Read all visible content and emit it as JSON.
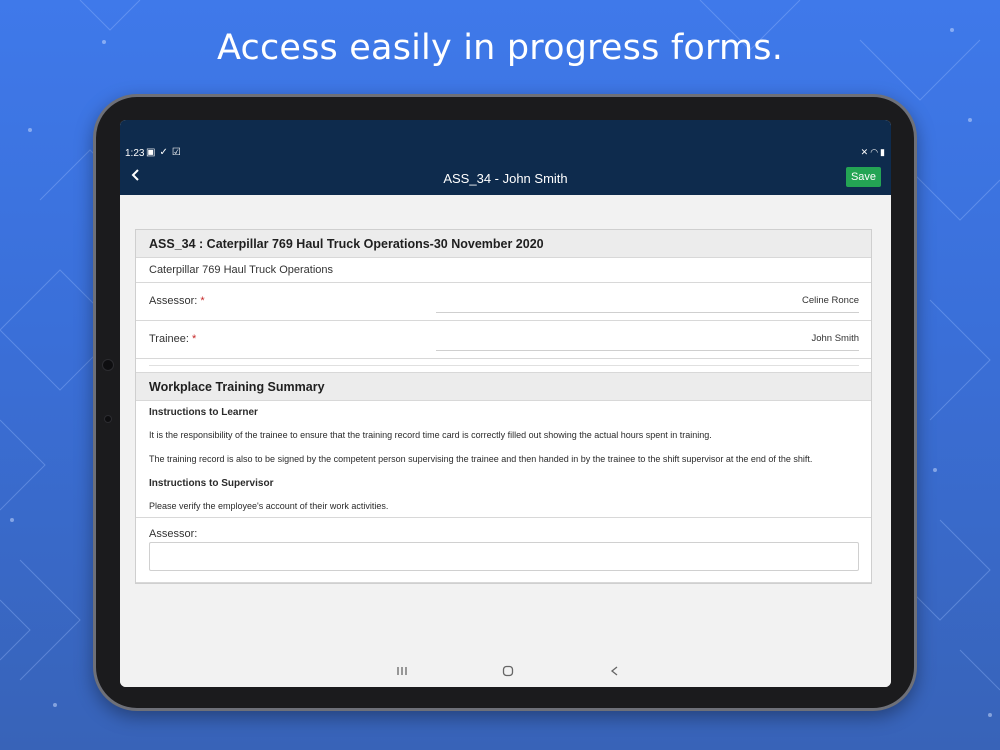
{
  "headline": "Access easily in progress forms.",
  "status_bar": {
    "time": "1:23",
    "left_icons": [
      "image-icon",
      "check-icon",
      "clipboard-icon"
    ],
    "right_icons": [
      "mute-icon",
      "wifi-icon",
      "battery-icon"
    ]
  },
  "app_bar": {
    "back_icon": "chevron-left-icon",
    "title": "ASS_34 - John Smith",
    "save_label": "Save"
  },
  "form": {
    "title": "ASS_34 : Caterpillar 769 Haul Truck Operations-30 November 2020",
    "subtitle": "Caterpillar 769 Haul Truck Operations",
    "assessor_label": "Assessor:",
    "assessor_required": "*",
    "assessor_value": "Celine Ronce",
    "trainee_label": "Trainee:",
    "trainee_required": "*",
    "trainee_value": "John Smith"
  },
  "summary": {
    "title": "Workplace Training Summary",
    "learner_heading": "Instructions to Learner",
    "learner_p1": "It is the responsibility of the trainee to ensure that the training record time card is correctly filled out showing the actual hours spent in training.",
    "learner_p2": "The training record is also to be signed by the competent person supervising the trainee and then handed in by the trainee to the shift supervisor at the end of the shift.",
    "supervisor_heading": "Instructions to Supervisor",
    "supervisor_p1": "Please verify the employee's account of their work activities.",
    "assessor_input_label": "Assessor:",
    "assessor_input_value": ""
  },
  "nav_bar": {
    "recents_icon": "recents-icon",
    "home_icon": "home-icon",
    "back_icon": "back-icon"
  },
  "colors": {
    "app_bar": "#0e2b4d",
    "save_button": "#24a454",
    "required": "#c62828",
    "background": "#3f79ea"
  }
}
